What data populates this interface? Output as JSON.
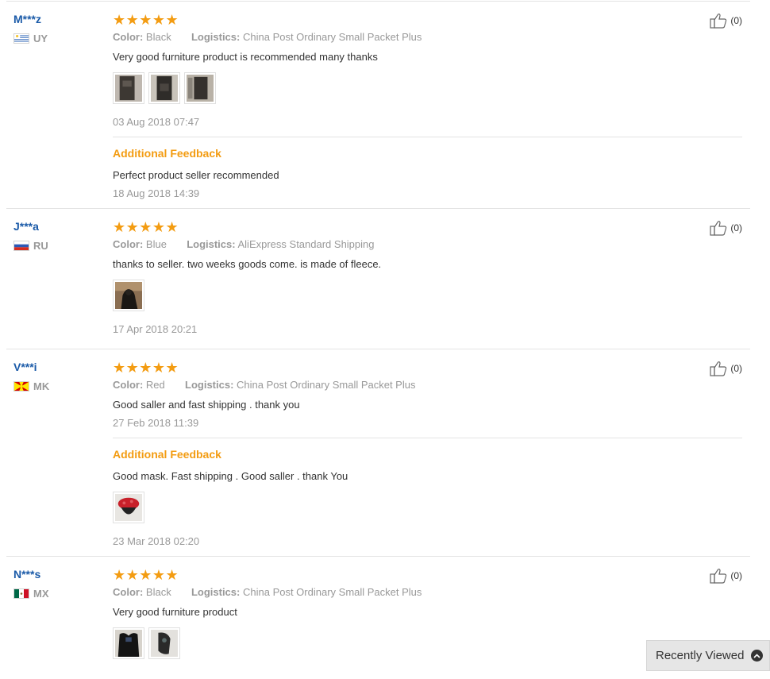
{
  "reviews": [
    {
      "user": "M***z",
      "country": "UY",
      "stars": "★★★★★",
      "color_label": "Color:",
      "color_value": "Black",
      "logistics_label": "Logistics:",
      "logistics_value": "China Post Ordinary Small Packet Plus",
      "text": "Very good furniture product is recommended many thanks",
      "date": "03 Aug 2018 07:47",
      "additional_title": "Additional Feedback",
      "additional_text": "Perfect product seller recommended",
      "additional_date": "18 Aug 2018 14:39",
      "useful": "(0)"
    },
    {
      "user": "J***a",
      "country": "RU",
      "stars": "★★★★★",
      "color_label": "Color:",
      "color_value": "Blue",
      "logistics_label": "Logistics:",
      "logistics_value": "AliExpress Standard Shipping",
      "text": "thanks to seller. two weeks goods come. is made of fleece.",
      "date": "17 Apr 2018 20:21",
      "useful": "(0)"
    },
    {
      "user": "V***i",
      "country": "MK",
      "stars": "★★★★★",
      "color_label": "Color:",
      "color_value": "Red",
      "logistics_label": "Logistics:",
      "logistics_value": "China Post Ordinary Small Packet Plus",
      "text": "Good saller and fast shipping . thank you",
      "date": "27 Feb 2018 11:39",
      "additional_title": "Additional Feedback",
      "additional_text": "Good mask. Fast shipping . Good saller . thank You",
      "additional_date": "23 Mar 2018 02:20",
      "useful": "(0)"
    },
    {
      "user": "N***s",
      "country": "MX",
      "stars": "★★★★★",
      "color_label": "Color:",
      "color_value": "Black",
      "logistics_label": "Logistics:",
      "logistics_value": "China Post Ordinary Small Packet Plus",
      "text": "Very good furniture product",
      "useful": "(0)"
    }
  ],
  "recently_viewed": {
    "label": "Recently Viewed"
  },
  "colors": {
    "user_link": "#1a5aa8",
    "star": "#f39c12",
    "additional": "#f39c12",
    "muted": "#999999"
  },
  "icons": {
    "useful": "thumbs-up-icon",
    "recently": "chevron-up-icon"
  }
}
